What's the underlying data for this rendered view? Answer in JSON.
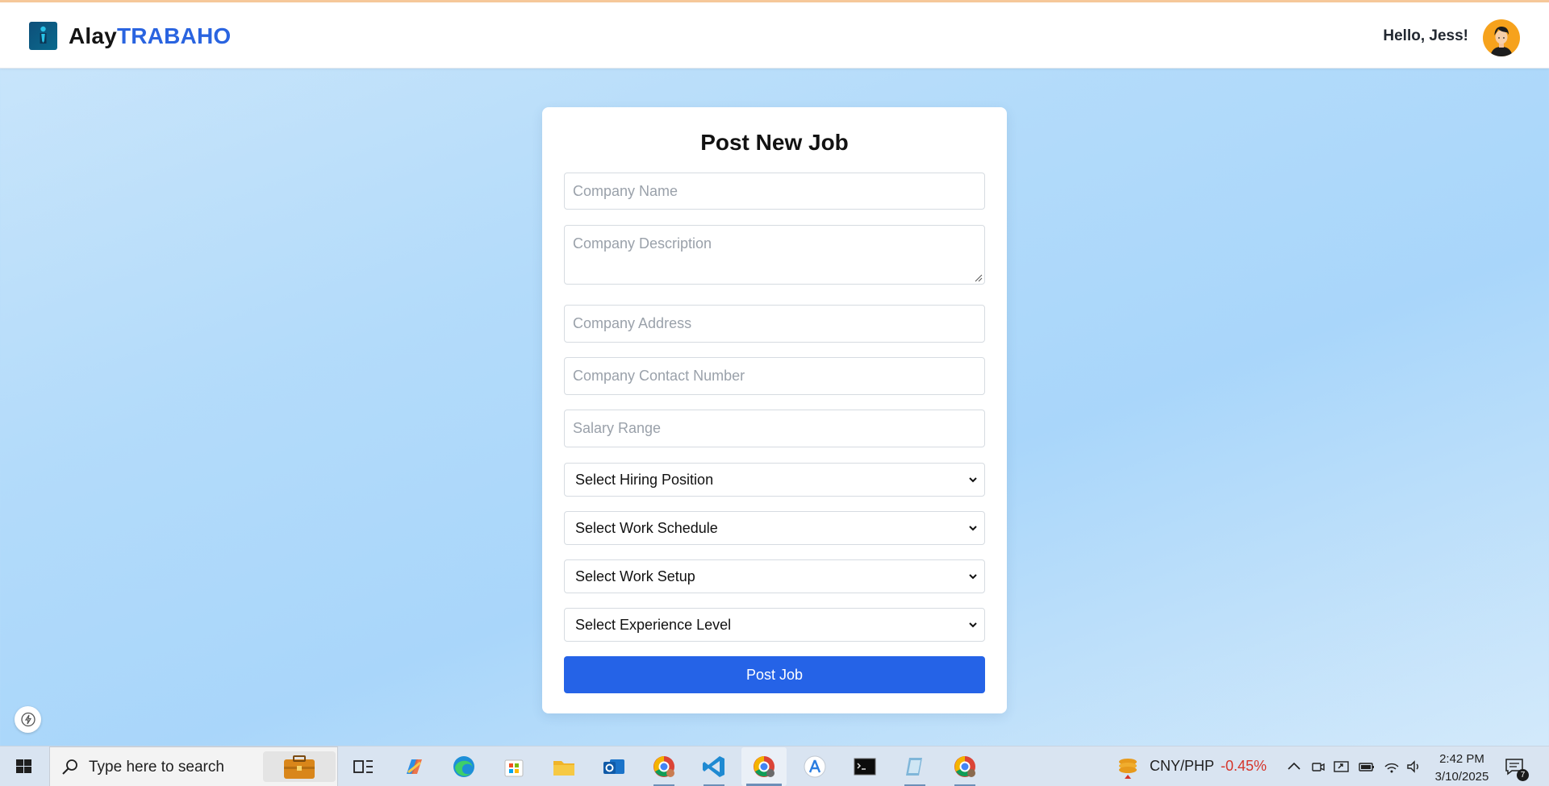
{
  "header": {
    "brand_primary": "Alay",
    "brand_accent": "TRABAHO",
    "greeting": "Hello, Jess!"
  },
  "form": {
    "title": "Post New Job",
    "company_name_placeholder": "Company Name",
    "company_description_placeholder": "Company Description",
    "company_address_placeholder": "Company Address",
    "company_contact_placeholder": "Company Contact Number",
    "salary_range_placeholder": "Salary Range",
    "hiring_position": "Select Hiring Position",
    "work_schedule": "Select Work Schedule",
    "work_setup": "Select Work Setup",
    "experience_level": "Select Experience Level",
    "submit_label": "Post Job"
  },
  "taskbar": {
    "search_placeholder": "Type here to search",
    "ticker_pair": "CNY/PHP",
    "ticker_change": "-0.45%",
    "time": "2:42 PM",
    "date": "3/10/2025",
    "notification_count": "7"
  },
  "colors": {
    "accent": "#2563e7",
    "brand_accent": "#2a64e0",
    "negative": "#d6352b"
  }
}
